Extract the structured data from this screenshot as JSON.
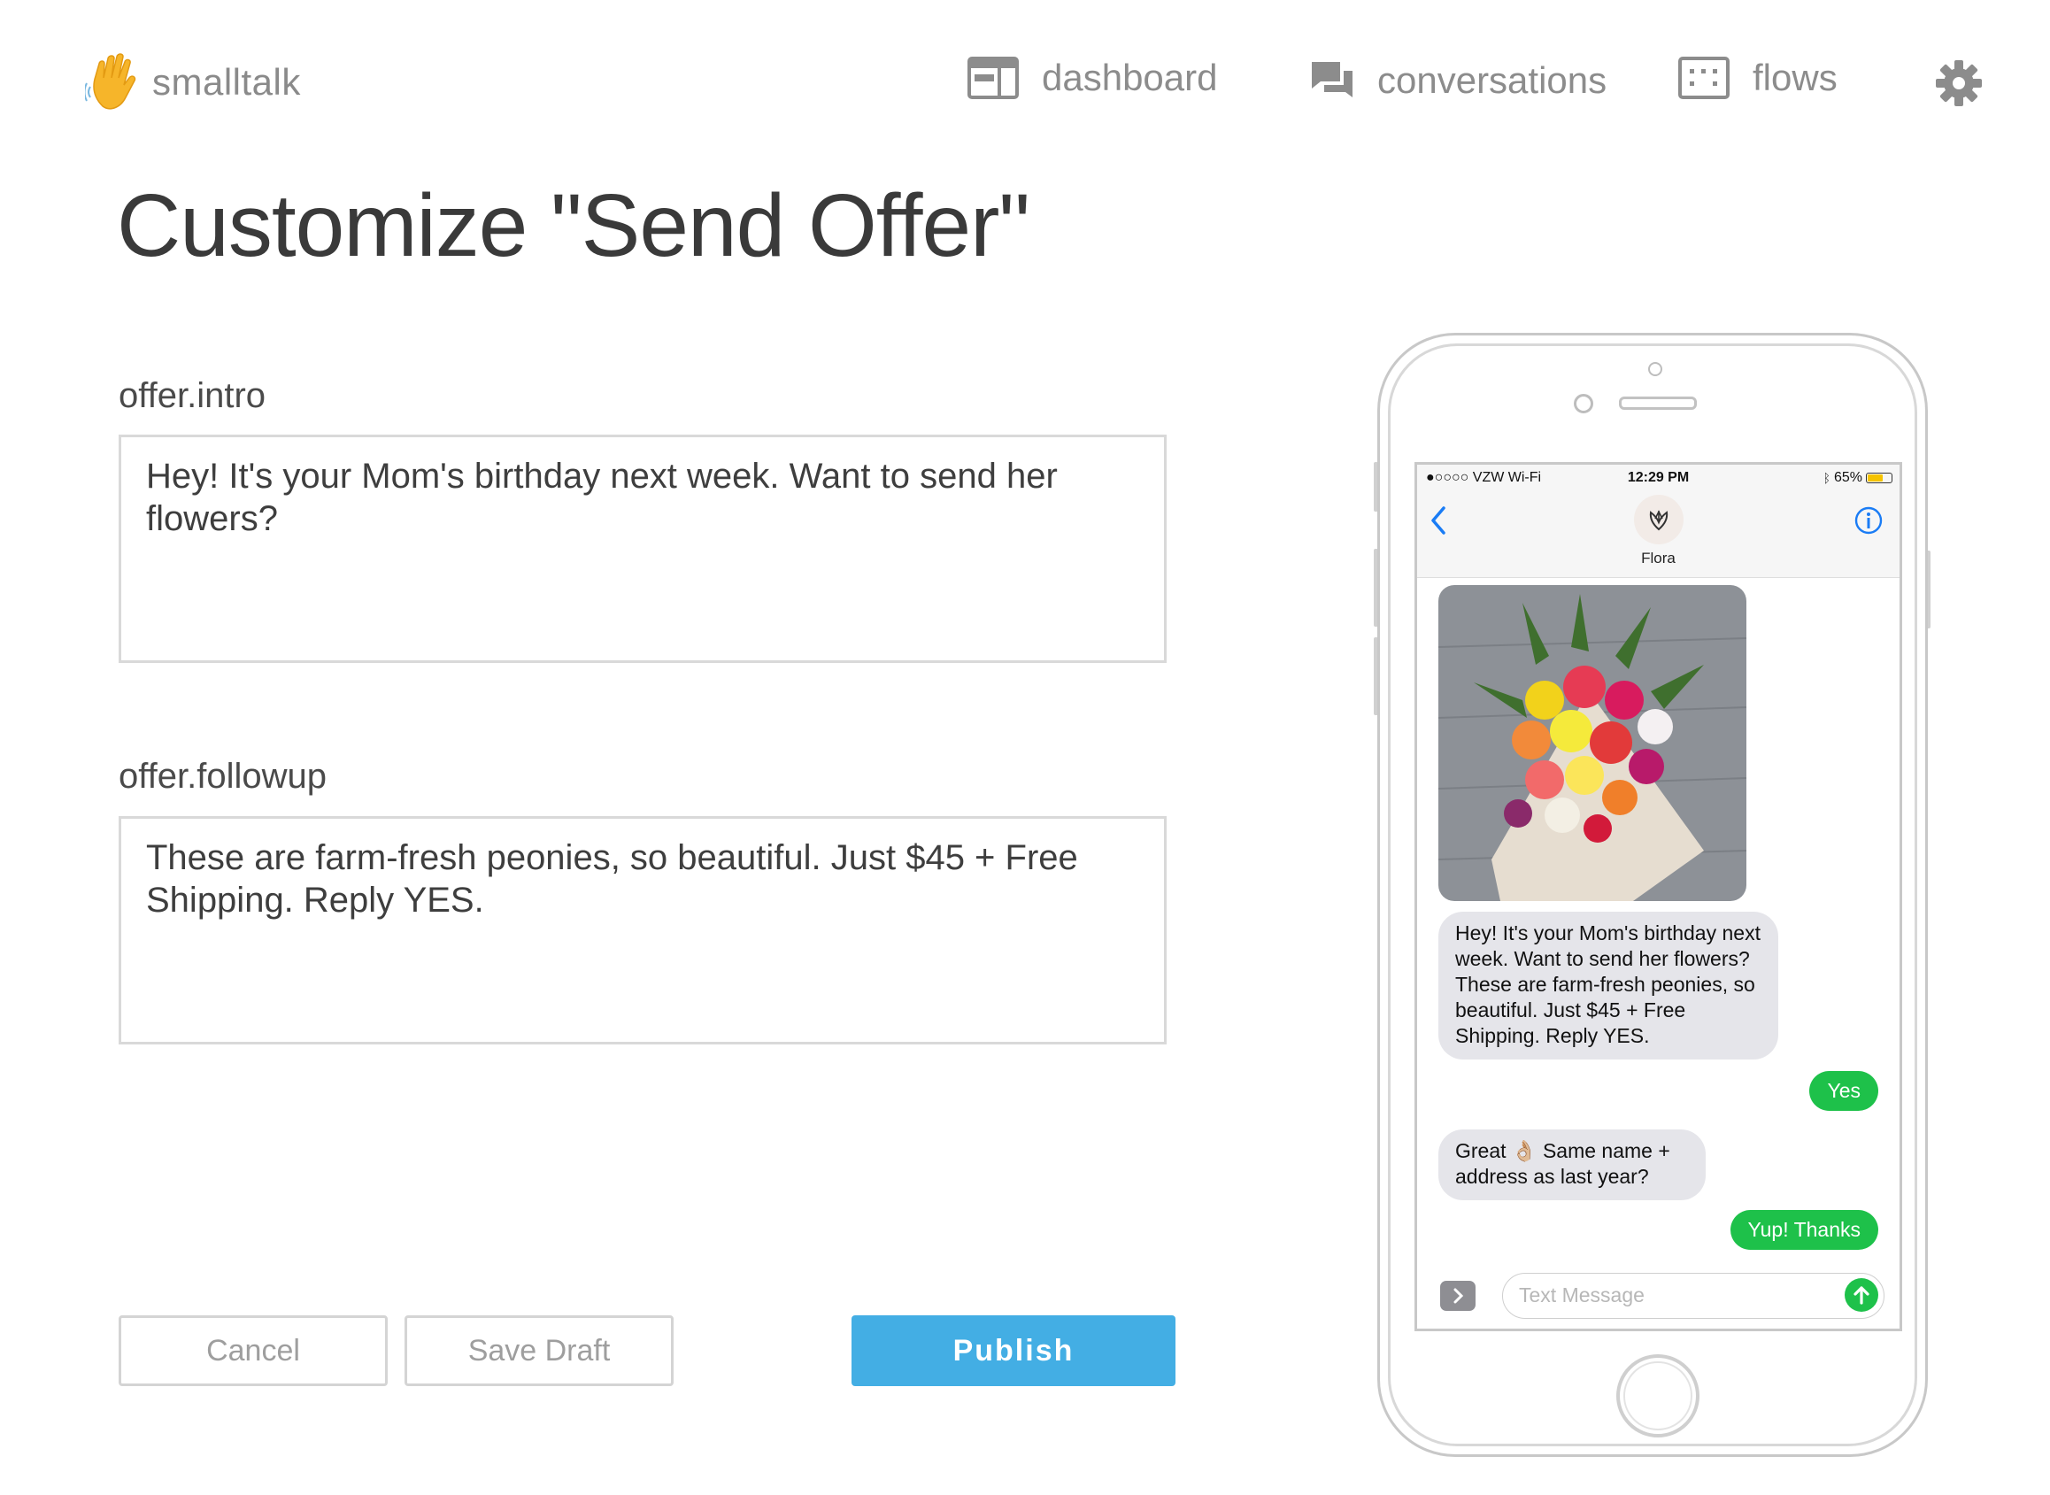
{
  "app": {
    "name": "smalltalk"
  },
  "nav": {
    "dashboard": "dashboard",
    "conversations": "conversations",
    "flows": "flows"
  },
  "page": {
    "title": "Customize \"Send Offer\""
  },
  "form": {
    "intro_label": "offer.intro",
    "intro_value": "Hey! It's your Mom's birthday next week. Want to send her flowers?",
    "followup_label": "offer.followup",
    "followup_value": "These are farm-fresh peonies, so beautiful. Just $45 + Free Shipping. Reply YES."
  },
  "buttons": {
    "cancel": "Cancel",
    "save_draft": "Save Draft",
    "publish": "Publish"
  },
  "phone": {
    "status": {
      "carrier": "●○○○○ VZW Wi-Fi",
      "time": "12:29 PM",
      "battery": "65%"
    },
    "contact": "Flora",
    "messages": [
      {
        "from": "them",
        "text": "Hey! It's your Mom's birthday next week. Want to send her flowers? These are farm-fresh peonies, so beautiful. Just $45 + Free Shipping. Reply YES."
      },
      {
        "from": "me",
        "text": "Yes"
      },
      {
        "from": "them",
        "text": "Great 👌🏼 Same name + address as last year?"
      },
      {
        "from": "me",
        "text": "Yup! Thanks"
      }
    ],
    "input_placeholder": "Text Message"
  },
  "colors": {
    "primary": "#43aee4",
    "imessage_green": "#1ec14a",
    "bubble_gray": "#e5e5ea",
    "logo_hand": "#f6b52a"
  },
  "icons": [
    "waving-hand-icon",
    "dashboard-icon",
    "chat-icon",
    "flows-icon",
    "gear-icon",
    "back-chevron-icon",
    "info-icon",
    "flora-logo-icon",
    "apps-chevron-icon",
    "send-arrow-icon"
  ]
}
